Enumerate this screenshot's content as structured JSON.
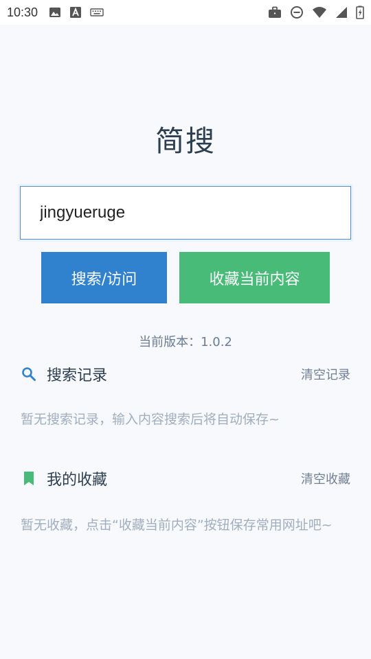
{
  "status_bar": {
    "time": "10:30",
    "left_icons": [
      "image-icon",
      "font-a-icon",
      "keyboard-icon"
    ],
    "right_icons": [
      "briefcase-icon",
      "do-not-disturb-icon",
      "wifi-icon",
      "cell-signal-icon",
      "battery-charging-icon"
    ]
  },
  "app": {
    "title": "简搜"
  },
  "search": {
    "value": "jingyueruge",
    "placeholder": ""
  },
  "buttons": {
    "search_label": "搜索/访问",
    "favorite_label": "收藏当前内容"
  },
  "version_text": "当前版本：1.0.2",
  "history": {
    "title": "搜索记录",
    "clear_label": "清空记录",
    "empty_text": "暂无搜索记录，输入内容搜索后将自动保存~"
  },
  "favorites": {
    "title": "我的收藏",
    "clear_label": "清空收藏",
    "empty_text": "暂无收藏，点击“收藏当前内容”按钮保存常用网址吧~"
  },
  "colors": {
    "primary": "#3182ce",
    "success": "#48bb78",
    "background": "#f7f9fc",
    "muted": "#a0aec0"
  }
}
